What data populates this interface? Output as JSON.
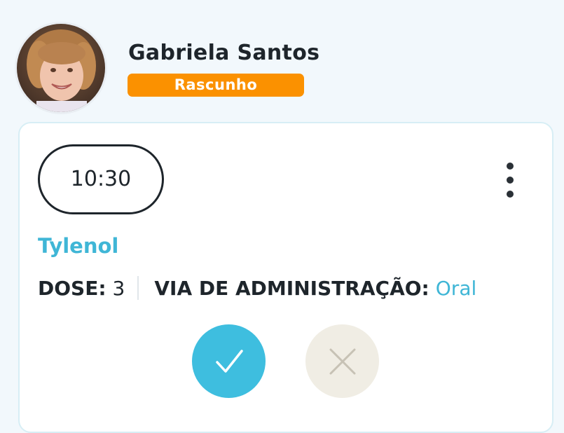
{
  "patient": {
    "name": "Gabriela Santos",
    "status": "Rascunho",
    "avatar_icon": "child-photo"
  },
  "medication": {
    "time": "10:30",
    "name": "Tylenol",
    "dose_label": "DOSE:",
    "dose_value": "3",
    "route_label": "VIA DE ADMINISTRAÇÃO:",
    "route_value": "Oral"
  },
  "actions": {
    "confirm_icon": "check-icon",
    "cancel_icon": "close-icon",
    "menu_icon": "more-vertical-icon"
  },
  "colors": {
    "accent": "#3ebedf",
    "status_orange": "#fb9100",
    "text_dark": "#1e252b",
    "cancel_bg": "#f0ede4"
  }
}
